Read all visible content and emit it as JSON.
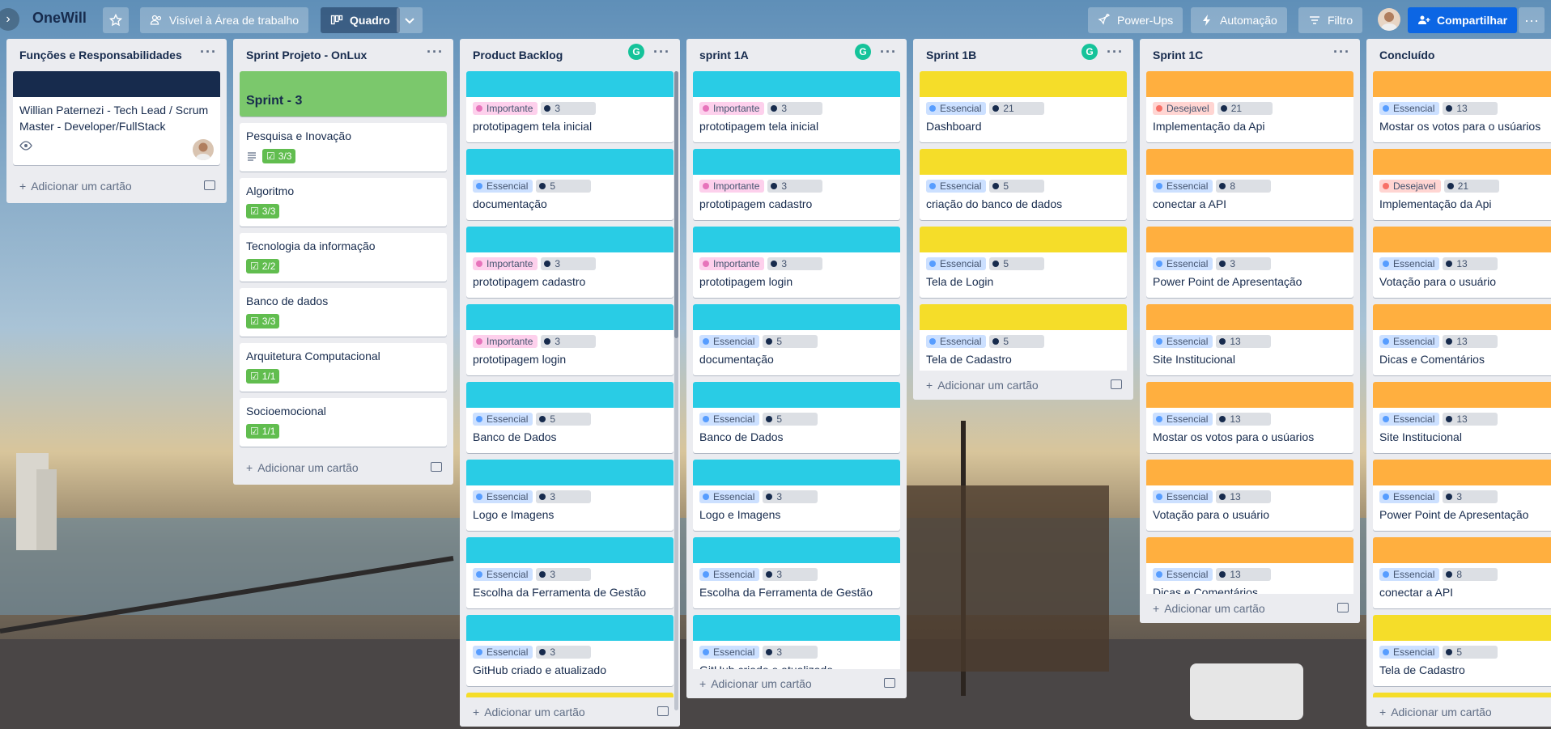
{
  "header": {
    "board_title": "OneWill",
    "visibility_label": "Visível à Área de trabalho",
    "view_label": "Quadro",
    "powerups_label": "Power-Ups",
    "automation_label": "Automação",
    "filter_label": "Filtro",
    "share_label": "Compartilhar"
  },
  "add_card_label": "Adicionar um cartão",
  "lists": [
    {
      "title": "Funções e Responsabilidades",
      "cards": [
        {
          "cover": "#172b4d",
          "title": "Willian Paternezi - Tech Lead / Scrum Master - Developer/FullStack"
        }
      ]
    },
    {
      "title": "Sprint Projeto - OnLux",
      "sprint_card": "Sprint - 3",
      "cards": [
        {
          "title": "Pesquisa e Inovação",
          "checklist": "3/3"
        },
        {
          "title": "Algoritmo",
          "checklist": "3/3"
        },
        {
          "title": "Tecnologia da informação",
          "checklist": "2/2"
        },
        {
          "title": "Banco de dados",
          "checklist": "3/3"
        },
        {
          "title": "Arquitetura Computacional",
          "checklist": "1/1"
        },
        {
          "title": "Socioemocional",
          "checklist": "1/1"
        }
      ]
    },
    {
      "title": "Product Backlog",
      "cards": [
        {
          "cover": "#29cce5",
          "label": "Importante",
          "points": "3",
          "title": "prototipagem tela inicial"
        },
        {
          "cover": "#29cce5",
          "label": "Essencial",
          "points": "5",
          "title": "documentação"
        },
        {
          "cover": "#29cce5",
          "label": "Importante",
          "points": "3",
          "title": "prototipagem cadastro"
        },
        {
          "cover": "#29cce5",
          "label": "Importante",
          "points": "3",
          "title": "prototipagem login"
        },
        {
          "cover": "#29cce5",
          "label": "Essencial",
          "points": "5",
          "title": "Banco de Dados"
        },
        {
          "cover": "#29cce5",
          "label": "Essencial",
          "points": "3",
          "title": "Logo e Imagens"
        },
        {
          "cover": "#29cce5",
          "label": "Essencial",
          "points": "3",
          "title": "Escolha da Ferramenta de Gestão"
        },
        {
          "cover": "#29cce5",
          "label": "Essencial",
          "points": "3",
          "title": "GitHub criado e atualizado"
        }
      ]
    },
    {
      "title": "sprint 1A",
      "cards": [
        {
          "cover": "#29cce5",
          "label": "Importante",
          "points": "3",
          "title": "prototipagem tela inicial"
        },
        {
          "cover": "#29cce5",
          "label": "Importante",
          "points": "3",
          "title": "prototipagem cadastro"
        },
        {
          "cover": "#29cce5",
          "label": "Importante",
          "points": "3",
          "title": "prototipagem login"
        },
        {
          "cover": "#29cce5",
          "label": "Essencial",
          "points": "5",
          "title": "documentação"
        },
        {
          "cover": "#29cce5",
          "label": "Essencial",
          "points": "5",
          "title": "Banco de Dados"
        },
        {
          "cover": "#29cce5",
          "label": "Essencial",
          "points": "3",
          "title": "Logo e Imagens"
        },
        {
          "cover": "#29cce5",
          "label": "Essencial",
          "points": "3",
          "title": "Escolha da Ferramenta de Gestão"
        },
        {
          "cover": "#29cce5",
          "label": "Essencial",
          "points": "3",
          "title": "GitHub criado e atualizado"
        }
      ]
    },
    {
      "title": "Sprint 1B",
      "cards": [
        {
          "cover": "#f5dd29",
          "label": "Essencial",
          "points": "21",
          "title": "Dashboard"
        },
        {
          "cover": "#f5dd29",
          "label": "Essencial",
          "points": "5",
          "title": "criação do banco de dados"
        },
        {
          "cover": "#f5dd29",
          "label": "Essencial",
          "points": "5",
          "title": "Tela de Login"
        },
        {
          "cover": "#f5dd29",
          "label": "Essencial",
          "points": "5",
          "title": "Tela de Cadastro"
        }
      ]
    },
    {
      "title": "Sprint 1C",
      "cards": [
        {
          "cover": "#ffaf3f",
          "label": "Desejavel",
          "points": "21",
          "title": "Implementação da Api"
        },
        {
          "cover": "#ffaf3f",
          "label": "Essencial",
          "points": "8",
          "title": "conectar a API"
        },
        {
          "cover": "#ffaf3f",
          "label": "Essencial",
          "points": "3",
          "title": "Power Point de Apresentação"
        },
        {
          "cover": "#ffaf3f",
          "label": "Essencial",
          "points": "13",
          "title": "Site Institucional"
        },
        {
          "cover": "#ffaf3f",
          "label": "Essencial",
          "points": "13",
          "title": "Mostar os votos para o usúarios"
        },
        {
          "cover": "#ffaf3f",
          "label": "Essencial",
          "points": "13",
          "title": "Votação para o usuário"
        },
        {
          "cover": "#ffaf3f",
          "label": "Essencial",
          "points": "13",
          "title": "Dicas e Comentários"
        }
      ]
    },
    {
      "title": "Concluído",
      "cards": [
        {
          "cover": "#ffaf3f",
          "label": "Essencial",
          "points": "13",
          "title": "Mostar os votos para o usúarios"
        },
        {
          "cover": "#ffaf3f",
          "label": "Desejavel",
          "points": "21",
          "title": "Implementação da Api"
        },
        {
          "cover": "#ffaf3f",
          "label": "Essencial",
          "points": "13",
          "title": "Votação para o usuário"
        },
        {
          "cover": "#ffaf3f",
          "label": "Essencial",
          "points": "13",
          "title": "Dicas e Comentários"
        },
        {
          "cover": "#ffaf3f",
          "label": "Essencial",
          "points": "13",
          "title": "Site Institucional"
        },
        {
          "cover": "#ffaf3f",
          "label": "Essencial",
          "points": "3",
          "title": "Power Point de Apresentação"
        },
        {
          "cover": "#ffaf3f",
          "label": "Essencial",
          "points": "8",
          "title": "conectar a API"
        },
        {
          "cover": "#f5dd29",
          "label": "Essencial",
          "points": "5",
          "title": "Tela de Cadastro"
        }
      ]
    }
  ]
}
